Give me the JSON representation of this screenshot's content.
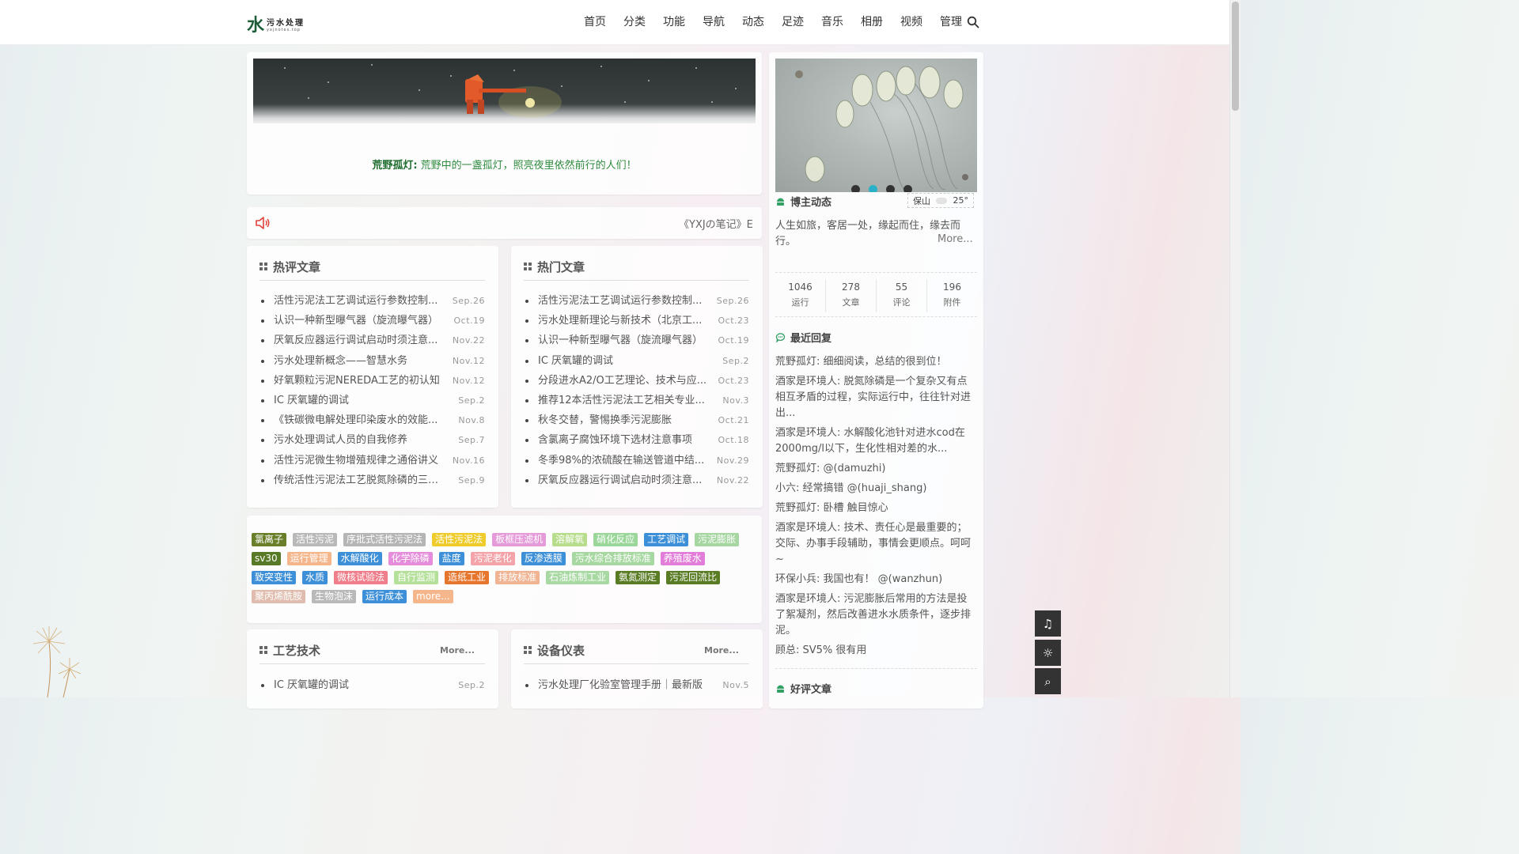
{
  "header": {
    "logo_char": "水",
    "logo_name": "污水处理",
    "logo_sub": "yxjnotes.top",
    "nav": [
      "首页",
      "分类",
      "功能",
      "导航",
      "动态",
      "足迹",
      "音乐",
      "相册",
      "视频",
      "管理"
    ]
  },
  "banner": {
    "quote_author": "荒野孤灯:",
    "quote_text": " 荒野中的一盏孤灯，照亮夜里依然前行的人们！"
  },
  "marquee": {
    "text": "《YXJの笔记》E"
  },
  "hot_comment": {
    "title": "热评文章",
    "items": [
      {
        "title": "活性污泥法工艺调试运行参数控制...",
        "date": "Sep.26"
      },
      {
        "title": "认识一种新型曝气器（旋流曝气器）",
        "date": "Oct.19"
      },
      {
        "title": "厌氧反应器运行调试启动时须注意...",
        "date": "Nov.22"
      },
      {
        "title": "污水处理新概念——智慧水务",
        "date": "Nov.12"
      },
      {
        "title": "好氧颗粒污泥NEREDA工艺的初认知",
        "date": "Nov.12"
      },
      {
        "title": "IC 厌氧罐的调试",
        "date": "Sep.2"
      },
      {
        "title": "《铁碳微电解处理印染废水的效能...",
        "date": "Nov.8"
      },
      {
        "title": "污水处理调试人员的自我修养",
        "date": "Sep.7"
      },
      {
        "title": "活性污泥微生物增殖规律之通俗讲义",
        "date": "Nov.16"
      },
      {
        "title": "传统活性污泥法工艺脱氮除磷的三个...",
        "date": "Sep.9"
      }
    ]
  },
  "hot_articles": {
    "title": "热门文章",
    "items": [
      {
        "title": "活性污泥法工艺调试运行参数控制...",
        "date": "Sep.26"
      },
      {
        "title": "污水处理新理论与新技术（北京工...",
        "date": "Oct.23"
      },
      {
        "title": "认识一种新型曝气器（旋流曝气器）",
        "date": "Oct.19"
      },
      {
        "title": "IC 厌氧罐的调试",
        "date": "Sep.2"
      },
      {
        "title": "分段进水A2/O工艺理论、技术与应...",
        "date": "Oct.23"
      },
      {
        "title": "推荐12本活性污泥法工艺相关专业...",
        "date": "Nov.3"
      },
      {
        "title": "秋冬交替，警惕换季污泥膨胀",
        "date": "Oct.21"
      },
      {
        "title": "含氯离子腐蚀环境下选材注意事项",
        "date": "Oct.18"
      },
      {
        "title": "冬季98%的浓硫酸在输送管道中结...",
        "date": "Nov.29"
      },
      {
        "title": "厌氧反应器运行调试启动时须注意...",
        "date": "Nov.22"
      }
    ]
  },
  "tags": [
    {
      "label": "氯离子",
      "color": "#6a7f2a"
    },
    {
      "label": "活性污泥",
      "color": "#b9b9b9"
    },
    {
      "label": "序批式活性污泥法",
      "color": "#b5b5b5"
    },
    {
      "label": "活性污泥法",
      "color": "#efcc2c"
    },
    {
      "label": "板框压滤机",
      "color": "#e59ad9"
    },
    {
      "label": "溶解氧",
      "color": "#b7dd8c"
    },
    {
      "label": "硝化反应",
      "color": "#9bd79a"
    },
    {
      "label": "工艺调试",
      "color": "#3d8fd8"
    },
    {
      "label": "污泥膨胀",
      "color": "#a6d6a2"
    },
    {
      "label": "sv30",
      "color": "#587a26"
    },
    {
      "label": "运行管理",
      "color": "#f5b68c"
    },
    {
      "label": "水解酸化",
      "color": "#3d8fd8"
    },
    {
      "label": "化学除磷",
      "color": "#e58ddb"
    },
    {
      "label": "盐度",
      "color": "#3d8fd8"
    },
    {
      "label": "污泥老化",
      "color": "#f4a3a8"
    },
    {
      "label": "反渗透膜",
      "color": "#3d8fd8"
    },
    {
      "label": "污水综合排放标准",
      "color": "#a8d8a2"
    },
    {
      "label": "养殖废水",
      "color": "#e27ed9"
    },
    {
      "label": "致突变性",
      "color": "#3d8fd8"
    },
    {
      "label": "水质",
      "color": "#3d8fd8"
    },
    {
      "label": "微核试验法",
      "color": "#f07d8a"
    },
    {
      "label": "自行监测",
      "color": "#b5e09a"
    },
    {
      "label": "造纸工业",
      "color": "#e6762d"
    },
    {
      "label": "排放标准",
      "color": "#f0b493"
    },
    {
      "label": "石油炼制工业",
      "color": "#a9d9a2"
    },
    {
      "label": "氨氮测定",
      "color": "#597c24"
    },
    {
      "label": "污泥回流比",
      "color": "#597c24"
    },
    {
      "label": "聚丙烯酰胺",
      "color": "#dfbcae"
    },
    {
      "label": "生物泡沫",
      "color": "#b9b9b9"
    },
    {
      "label": "运行成本",
      "color": "#3d8fd8"
    },
    {
      "label": "more...",
      "color": "#f5b68c"
    }
  ],
  "tech": {
    "title": "工艺技术",
    "more": "More...",
    "items": [
      {
        "title": "IC 厌氧罐的调试",
        "date": "Sep.2"
      }
    ]
  },
  "equipment": {
    "title": "设备仪表",
    "more": "More...",
    "items": [
      {
        "title": "污水处理厂化验室管理手册｜最新版",
        "date": "Nov.5"
      }
    ]
  },
  "sidebar": {
    "blogger_title": "博主动态",
    "weather_city": "保山",
    "weather_temp": "25°",
    "motto": "人生如旅，客居一处，缘起而住，缘去而行。",
    "motto_more": "More...",
    "stats": [
      {
        "value": "1046",
        "label": "运行"
      },
      {
        "value": "278",
        "label": "文章"
      },
      {
        "value": "55",
        "label": "评论"
      },
      {
        "value": "196",
        "label": "附件"
      }
    ],
    "replies_title": "最近回复",
    "replies": [
      "荒野孤灯: 细细阅读，总结的很到位！",
      "酒家是环境人: 脱氮除磷是一个复杂又有点相互矛盾的过程，实际运行中，往往针对进出...",
      "酒家是环境人: 水解酸化池针对进水cod在2000mg/l以下，生化性相对差的水...",
      "荒野孤灯: @(damuzhi)",
      "小六: 经常搞错 @(huaji_shang)",
      "荒野孤灯: 卧槽 触目惊心",
      "酒家是环境人: 技术、责任心是最重要的；交际、办事手段辅助，事情会更顺点。呵呵~",
      "环保小兵: 我国也有！ @(wanzhun)",
      "酒家是环境人: 污泥膨胀后常用的方法是投了絮凝剂，然后改善进水水质条件，逐步排泥。",
      "顾总: SV5% 很有用"
    ],
    "good_title": "好评文章"
  },
  "float_buttons": [
    "♫",
    "☼",
    "⌕"
  ],
  "colors": {
    "accent_green": "#2e8a3e",
    "tag_blue": "#3d8fd8",
    "dark_button": "#333333"
  }
}
